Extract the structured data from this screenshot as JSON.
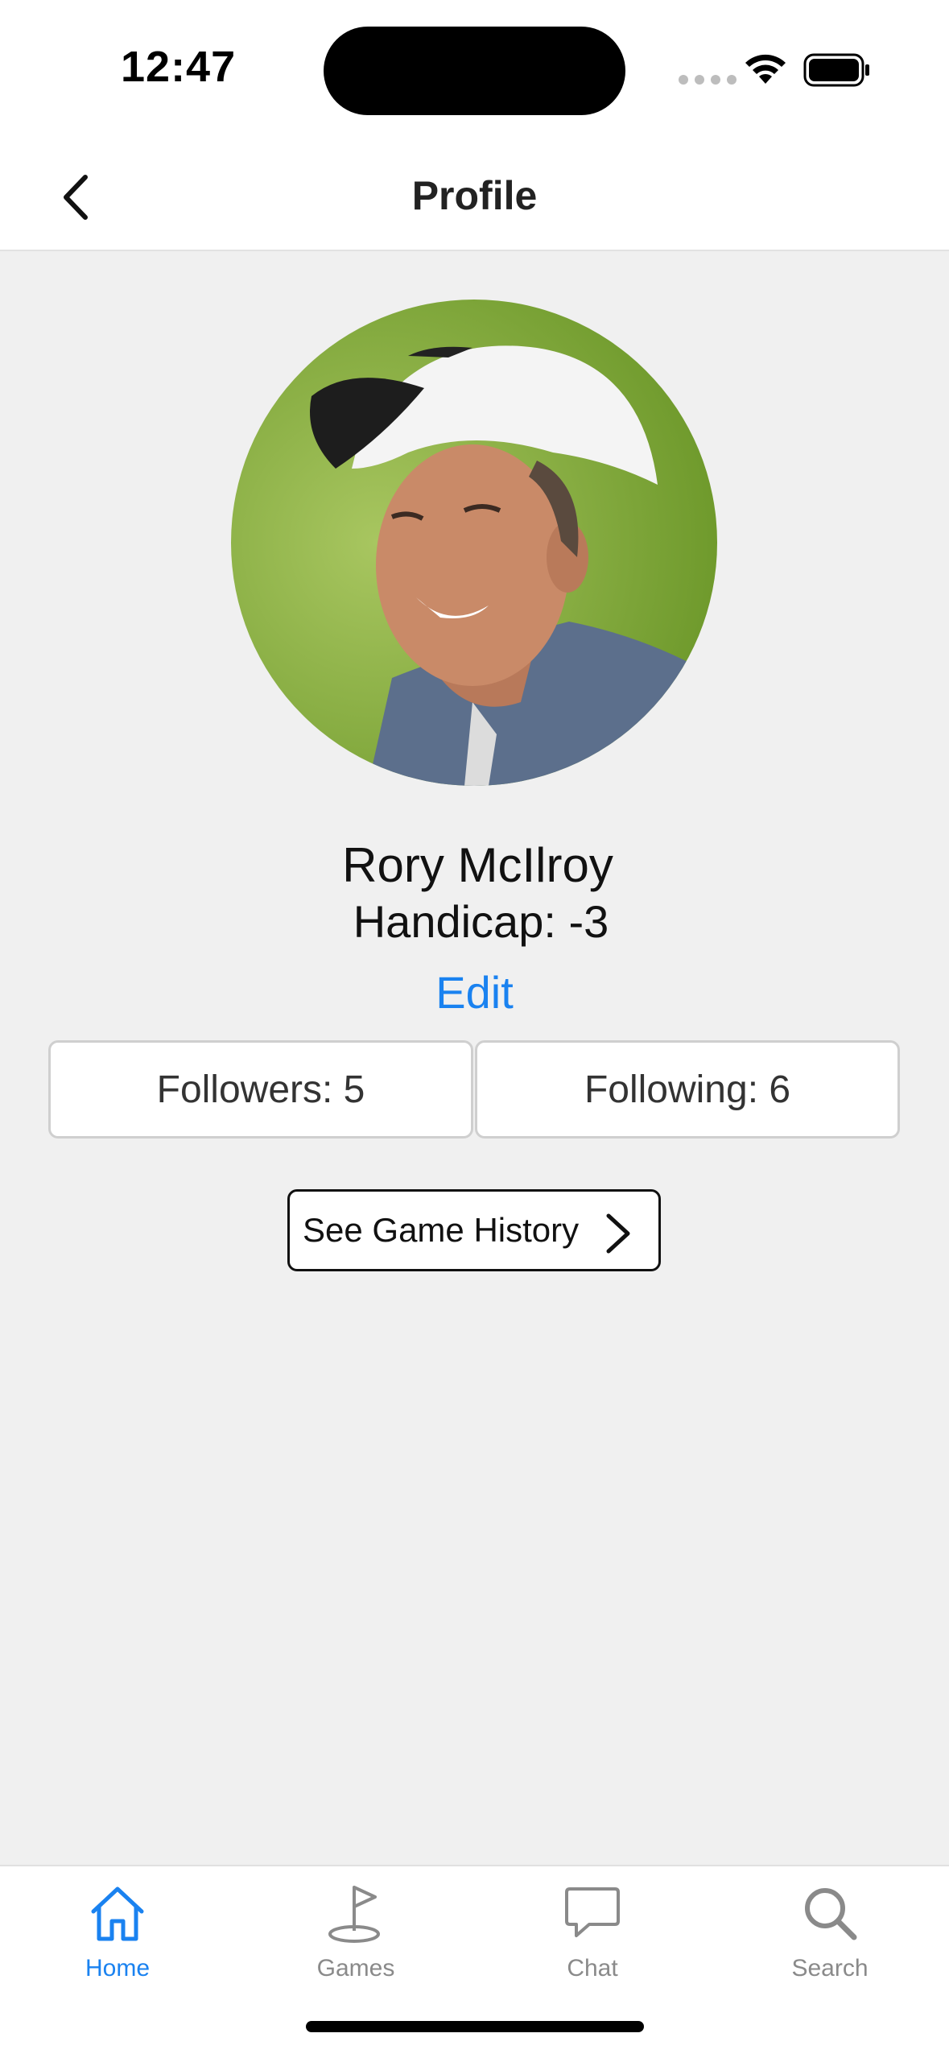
{
  "status_bar": {
    "time": "12:47"
  },
  "nav": {
    "title": "Profile",
    "back_icon": "chevron-left-icon"
  },
  "profile": {
    "avatar_icon": "profile-photo",
    "name": "Rory McIlroy",
    "handicap": "Handicap: -3",
    "edit_label": "Edit",
    "followers_label": "Followers: 5",
    "following_label": "Following: 6",
    "history_label": "See Game History",
    "history_icon": "chevron-right-icon"
  },
  "tabs": [
    {
      "label": "Home",
      "icon": "home-icon",
      "active": true
    },
    {
      "label": "Games",
      "icon": "golf-flag-icon",
      "active": false
    },
    {
      "label": "Chat",
      "icon": "chat-bubble-icon",
      "active": false
    },
    {
      "label": "Search",
      "icon": "search-icon",
      "active": false
    }
  ],
  "colors": {
    "accent": "#1a82f0",
    "background": "#f0f0f0",
    "inactive_tab": "#8a8a8a"
  }
}
